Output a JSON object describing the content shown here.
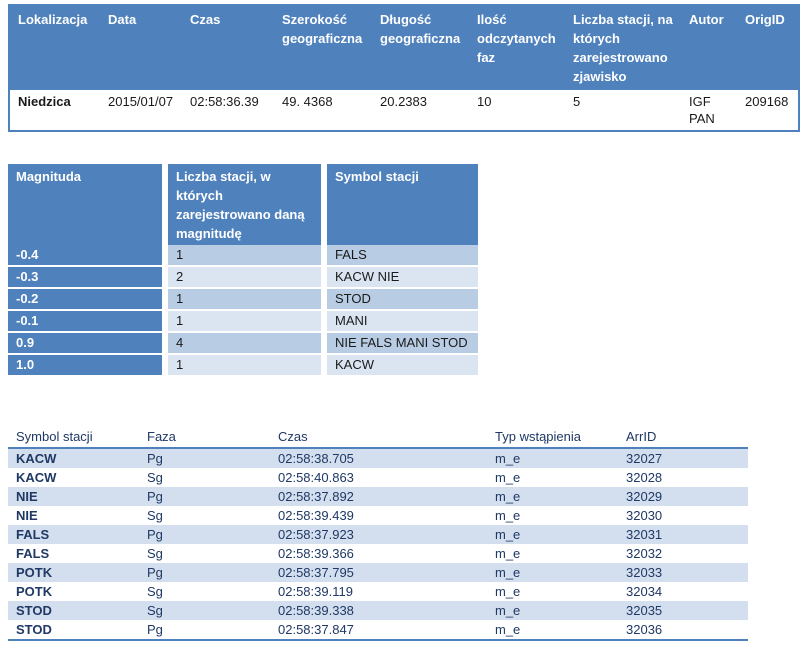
{
  "event_table": {
    "headers": [
      "Lokalizacja",
      "Data",
      "Czas",
      "Szerokość geograficzna",
      "Długość geograficzna",
      "Ilość odczytanych faz",
      "Liczba stacji, na których zarejestrowano zjawisko",
      "Autor",
      "OrigID"
    ],
    "row": [
      "Niedzica",
      "2015/01/07",
      "02:58:36.39",
      "49. 4368",
      "20.2383",
      "10",
      "5",
      "IGF PAN",
      "209168"
    ]
  },
  "magnitude_table": {
    "headers": [
      "Magnituda",
      "Liczba stacji, w których zarejestrowano daną magnitudę",
      "Symbol stacji"
    ],
    "rows": [
      [
        "-0.4",
        "1",
        "FALS"
      ],
      [
        "-0.3",
        "2",
        "KACW NIE"
      ],
      [
        "-0.2",
        "1",
        "STOD"
      ],
      [
        "-0.1",
        "1",
        "MANI"
      ],
      [
        "0.9",
        "4",
        "NIE FALS MANI STOD"
      ],
      [
        "1.0",
        "1",
        "KACW"
      ]
    ]
  },
  "arrivals_table": {
    "headers": [
      "Symbol stacji",
      "Faza",
      "Czas",
      "Typ wstąpienia",
      "ArrID"
    ],
    "rows": [
      [
        "KACW",
        "Pg",
        "02:58:38.705",
        "m_e",
        "32027"
      ],
      [
        "KACW",
        "Sg",
        "02:58:40.863",
        "m_e",
        "32028"
      ],
      [
        "NIE",
        "Pg",
        "02:58:37.892",
        "m_e",
        "32029"
      ],
      [
        "NIE",
        "Sg",
        "02:58:39.439",
        "m_e",
        "32030"
      ],
      [
        "FALS",
        "Pg",
        "02:58:37.923",
        "m_e",
        "32031"
      ],
      [
        "FALS",
        "Sg",
        "02:58:39.366",
        "m_e",
        "32032"
      ],
      [
        "POTK",
        "Pg",
        "02:58:37.795",
        "m_e",
        "32033"
      ],
      [
        "POTK",
        "Sg",
        "02:58:39.119",
        "m_e",
        "32034"
      ],
      [
        "STOD",
        "Sg",
        "02:58:39.338",
        "m_e",
        "32035"
      ],
      [
        "STOD",
        "Pg",
        "02:58:37.847",
        "m_e",
        "32036"
      ]
    ]
  },
  "colors": {
    "header_blue": "#4f81bd",
    "row_shade": "#b8cce4",
    "row_light": "#dbe5f1",
    "arrivals_shade": "#d3dfee",
    "arrivals_text": "#1f3864"
  }
}
